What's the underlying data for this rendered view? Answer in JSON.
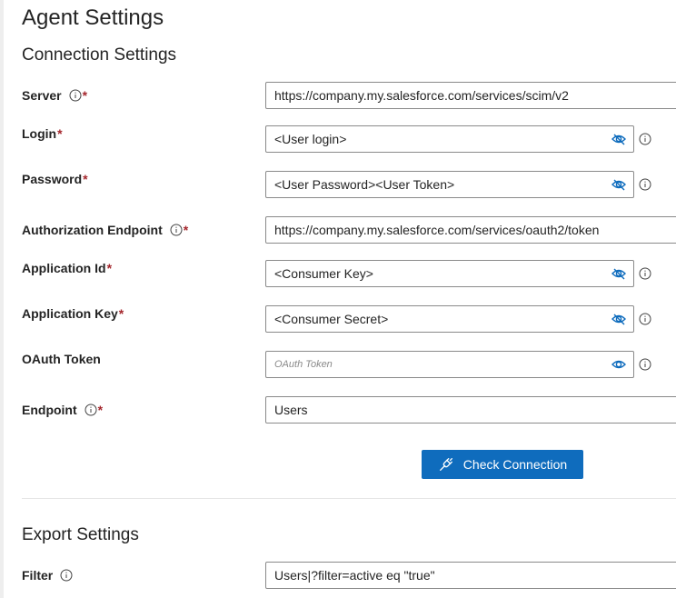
{
  "page": {
    "title": "Agent Settings"
  },
  "connection": {
    "heading": "Connection Settings",
    "server": {
      "label": "Server",
      "value": "https://company.my.salesforce.com/services/scim/v2"
    },
    "login": {
      "label": "Login",
      "value": "<User login>"
    },
    "password": {
      "label": "Password",
      "value": "<User Password><User Token>"
    },
    "auth_endpoint": {
      "label": "Authorization Endpoint",
      "value": "https://company.my.salesforce.com/services/oauth2/token"
    },
    "app_id": {
      "label": "Application Id",
      "value": "<Consumer Key>"
    },
    "app_key": {
      "label": "Application Key",
      "value": "<Consumer Secret>"
    },
    "oauth_token": {
      "label": "OAuth Token",
      "placeholder": "OAuth Token"
    },
    "endpoint": {
      "label": "Endpoint",
      "value": "Users"
    },
    "check_button": "Check Connection",
    "required_mark": "*"
  },
  "export": {
    "heading": "Export Settings",
    "filter": {
      "label": "Filter",
      "value": "Users|?filter=active eq \"true\""
    }
  },
  "icons": {
    "info": "info-circle-icon",
    "eye_hidden": "eye-hidden-icon",
    "eye": "eye-icon",
    "plug": "plug-connection-icon"
  },
  "colors": {
    "accent": "#0f6cbd",
    "required": "#a4262c",
    "border": "#8a8a8a"
  }
}
